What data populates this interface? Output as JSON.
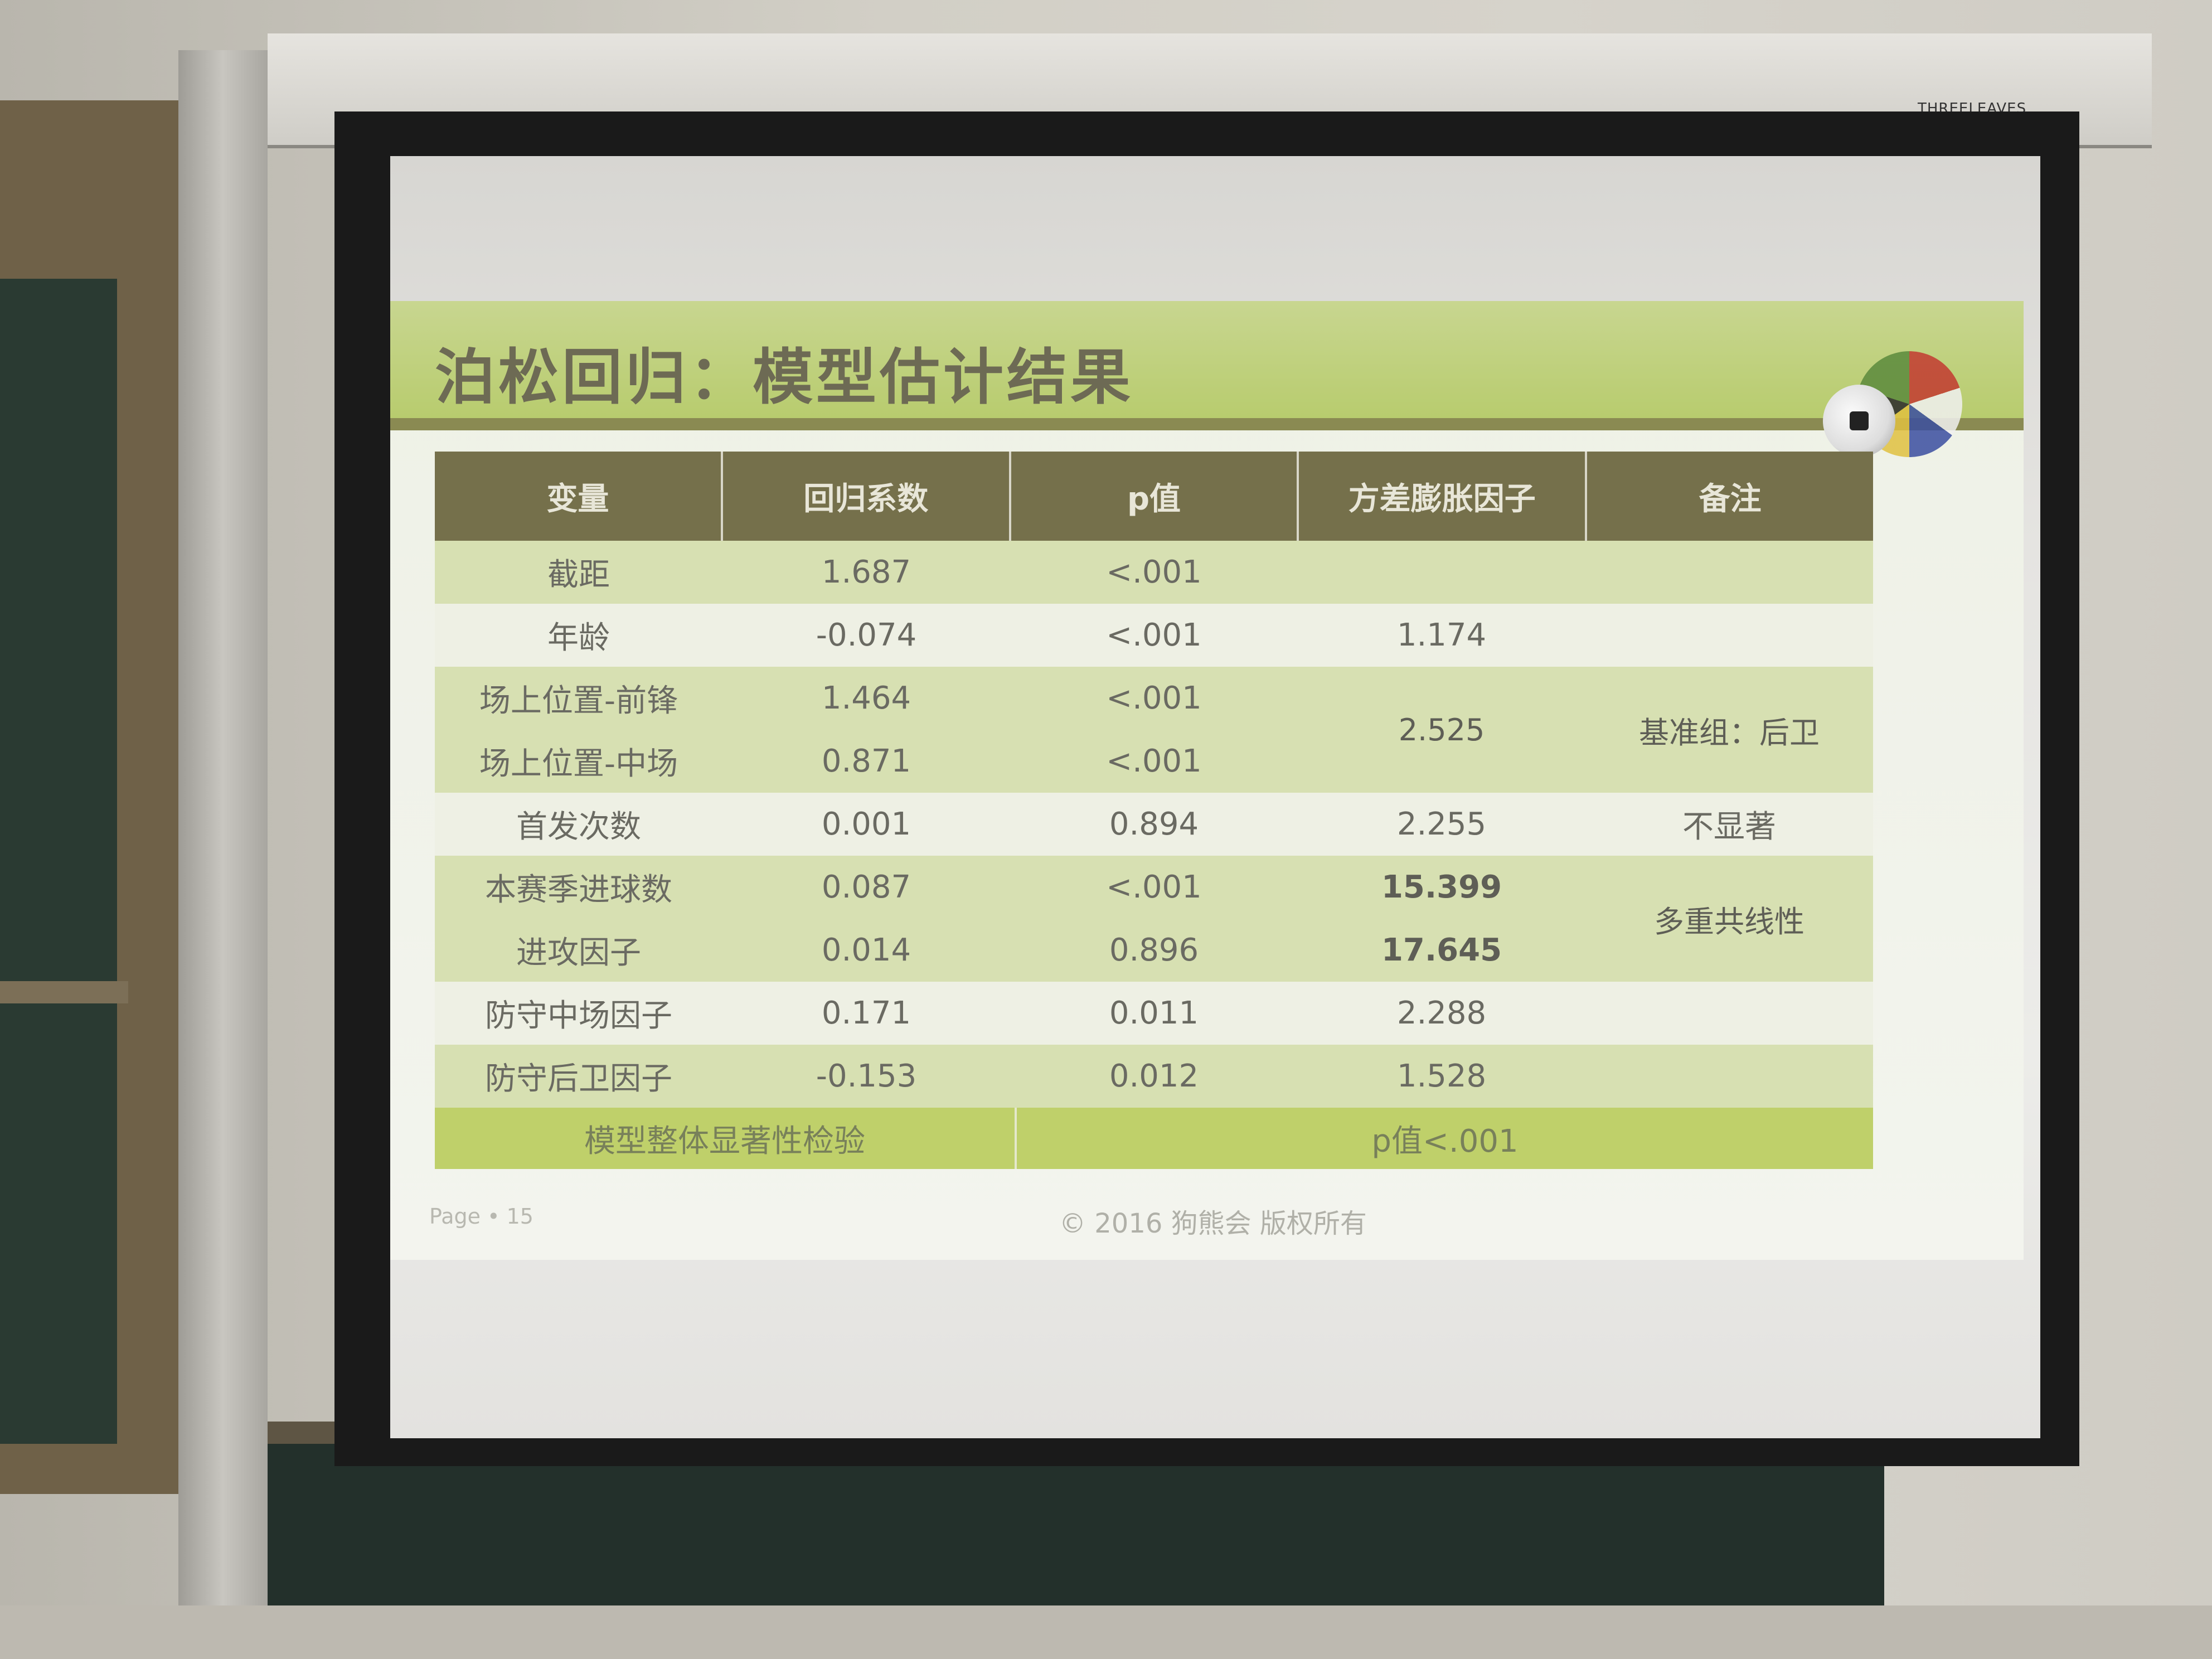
{
  "screen_brand": "THREELEAVES",
  "slide": {
    "title": "泊松回归：模型估计结果",
    "headers": [
      "变量",
      "回归系数",
      "p值",
      "方差膨胀因子",
      "备注"
    ],
    "rows": [
      {
        "var": "截距",
        "coef": "1.687",
        "p": "<.001",
        "vif": ""
      },
      {
        "var": "年龄",
        "coef": "-0.074",
        "p": "<.001",
        "vif": "1.174"
      },
      {
        "var": "场上位置-前锋",
        "coef": "1.464",
        "p": "<.001",
        "vif": ""
      },
      {
        "var": "场上位置-中场",
        "coef": "0.871",
        "p": "<.001",
        "vif": ""
      },
      {
        "var": "首发次数",
        "coef": "0.001",
        "p": "0.894",
        "vif": "2.255"
      },
      {
        "var": "本赛季进球数",
        "coef": "0.087",
        "p": "<.001",
        "vif": "15.399"
      },
      {
        "var": "进攻因子",
        "coef": "0.014",
        "p": "0.896",
        "vif": "17.645"
      },
      {
        "var": "防守中场因子",
        "coef": "0.171",
        "p": "0.011",
        "vif": "2.288"
      },
      {
        "var": "防守后卫因子",
        "coef": "-0.153",
        "p": "0.012",
        "vif": "1.528"
      }
    ],
    "merged": {
      "position_vif": "2.525",
      "position_note": "基准组：后卫",
      "starts_note": "不显著",
      "collinearity_note": "多重共线性"
    },
    "footer": {
      "label": "模型整体显著性检验",
      "value": "p值<.001"
    },
    "page": "Page • 15",
    "copyright": "© 2016 狗熊会 版权所有"
  }
}
